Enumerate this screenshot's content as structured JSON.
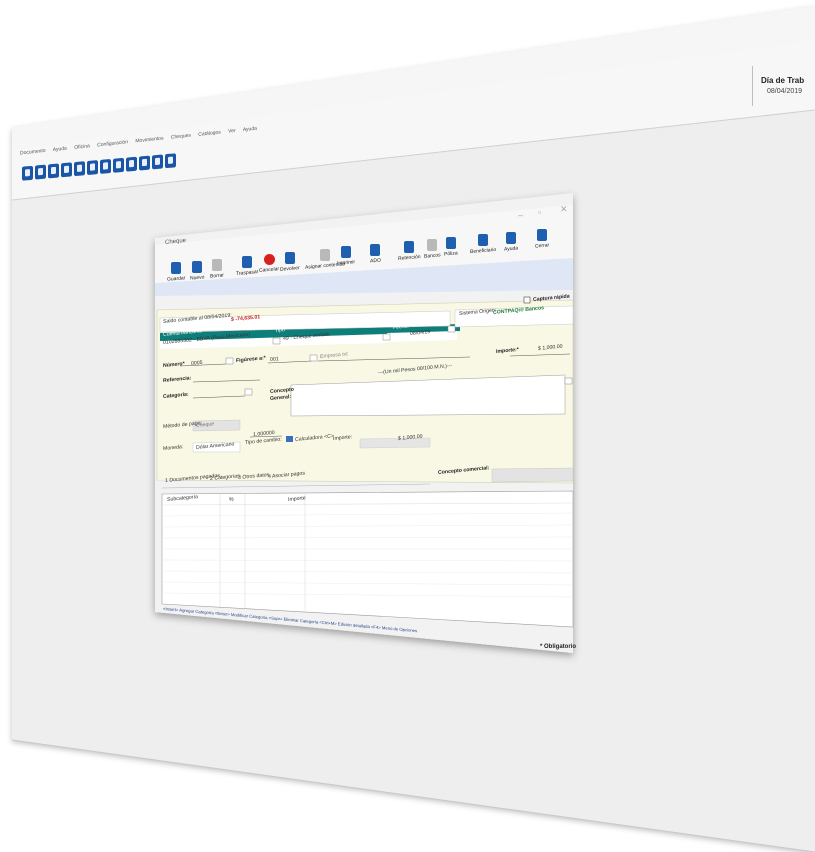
{
  "status": {
    "title": "Día de Trab",
    "date": "08/04/2019"
  },
  "menubar": [
    "Documento",
    "Ayuda",
    "Oficina",
    "Configuración",
    "Movimientos",
    "Cheques",
    "Catálogos",
    "Ver",
    "Ayuda"
  ],
  "dialog": {
    "title": "Cheque",
    "ribbon": [
      {
        "name": "guardar",
        "label": "Guardar",
        "color": "blue"
      },
      {
        "name": "nuevo",
        "label": "Nuevo",
        "color": "blue"
      },
      {
        "name": "borrar",
        "label": "Borrar",
        "color": "gray"
      },
      {
        "name": "traspasar",
        "label": "Traspasar",
        "color": "blue"
      },
      {
        "name": "cancelar",
        "label": "Cancelar",
        "color": "red"
      },
      {
        "name": "devolver",
        "label": "Devolver",
        "color": "blue"
      },
      {
        "name": "asignar-contenido",
        "label": "Asignar contenido",
        "color": "gray"
      },
      {
        "name": "imprimir",
        "label": "Imprimir",
        "color": "blue"
      },
      {
        "name": "ado",
        "label": "ADO",
        "color": "blue"
      },
      {
        "name": "retencion",
        "label": "Retención",
        "color": "blue"
      },
      {
        "name": "bancos",
        "label": "Bancos",
        "color": "gray"
      },
      {
        "name": "poliza",
        "label": "Póliza",
        "color": "blue"
      },
      {
        "name": "beneficiario",
        "label": "Beneficiario",
        "color": "blue"
      },
      {
        "name": "ayuda",
        "label": "Ayuda",
        "color": "blue"
      },
      {
        "name": "cerrar",
        "label": "Cerrar",
        "color": "blue"
      }
    ],
    "captura_rapida": "Captura rápida",
    "saldo_label": "Saldo contable al 08/04/2019:",
    "saldo_value": "$ -74,635.01",
    "sistema_origen_label": "Sistema Origen:",
    "sistema_origen_value": "CONTPAQi® Bancos",
    "cuenta_label": "Cuenta bancaria:*",
    "cuenta_value": "0102685502 - BBVA (Peso Mexicano)",
    "tipo_label": "Tipo*",
    "tipo_value": "49 - Cheque emitido",
    "fecha_label": "Fecha:*",
    "fecha_value": "08/04/19",
    "f3": "F3",
    "numero_label": "Número*",
    "numero_value": "0005",
    "figura_label": "Figúrese a:*",
    "figura_value": "001",
    "empresa_value": "Empresa txt",
    "importe_label": "Importe:*",
    "importe_value": "$ 1,000.00",
    "letra": "---(Un mil Pesos 00/100 M.N.)---",
    "referencia_label": "Referencia:",
    "categoria_label": "Categoría:",
    "concepto_label": "Concepto",
    "general_label": "General:",
    "metodo_label": "Método de pago:",
    "metodo_value": "Cheque",
    "moneda_label": "Moneda:",
    "moneda_value": "Dólar Americano",
    "tipo_cambio_label": "Tipo de cambio:",
    "tipo_cambio_value": "1.000000",
    "calculadora_label": "Calculadora <C>",
    "importe2_label": "Importe:",
    "importe2_value": "$ 1,000.00",
    "tabs": [
      "1 Documentos pagados",
      "2 Categorías",
      "3 Otros datos",
      "4 Asociar pagos"
    ],
    "concepto_comercial_label": "Concepto comercial:",
    "grid_headers": [
      "Subcategoría",
      "%",
      "Importe"
    ],
    "footer_hints": "<Insert> Agregar Categoría  <Enter> Modificar Categoría  <Supr> Eliminar Categoría  <Ctrl+M> Edición detallada  <F4> Menú de Opciones",
    "obligatorio": "* Obligatorio"
  }
}
